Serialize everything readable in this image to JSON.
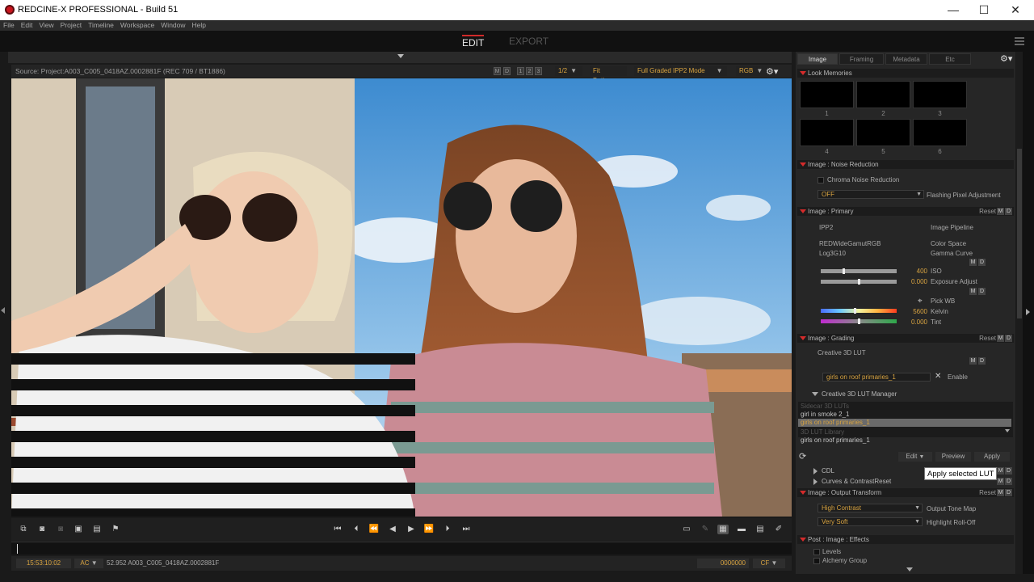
{
  "window": {
    "title": "REDCINE-X PROFESSIONAL - Build 51",
    "minimize": "—",
    "maximize": "☐",
    "close": "✕"
  },
  "menu": [
    "File",
    "Edit",
    "View",
    "Project",
    "Timeline",
    "Workspace",
    "Window",
    "Help"
  ],
  "modes": {
    "edit": "EDIT",
    "export": "EXPORT"
  },
  "viewer": {
    "source": "Source: Project:A003_C005_0418AZ.0002881F    (REC 709 / BT1886)",
    "m": "M",
    "d": "D",
    "pages": [
      "1",
      "2",
      "3"
    ],
    "zoom": "1/2",
    "fit": "Fit Both",
    "mode": "Full Graded IPP2 Mode",
    "channel": "RGB"
  },
  "transport": {
    "timecode": "15:53:10:02",
    "ac": "AC",
    "clip": "52.952 A003_C005_0418AZ.0002881F",
    "frame": "0000000",
    "cf": "CF"
  },
  "panel": {
    "tabs": [
      "Image",
      "Framing",
      "Metadata",
      "Etc"
    ],
    "look_memories": {
      "title": "Look Memories",
      "slots": [
        "1",
        "2",
        "3",
        "4",
        "5",
        "6"
      ]
    },
    "noise_reduction": {
      "title": "Image : Noise Reduction",
      "chroma": "Chroma Noise Reduction",
      "off": "OFF",
      "flashing": "Flashing Pixel Adjustment"
    },
    "primary": {
      "title": "Image : Primary",
      "reset": "Reset",
      "pipeline_value": "IPP2",
      "pipeline_label": "Image Pipeline",
      "colorspace_value": "REDWideGamutRGB",
      "colorspace_label": "Color Space",
      "gamma_value": "Log3G10",
      "gamma_label": "Gamma Curve",
      "iso_value": "400",
      "iso_label": "ISO",
      "iso_level": 0.3,
      "exposure_value": "0.000",
      "exposure_label": "Exposure Adjust",
      "exposure_level": 0.5,
      "pick_wb": "Pick WB",
      "kelvin_value": "5600",
      "kelvin_label": "Kelvin",
      "kelvin_level": 0.45,
      "tint_value": "0.000",
      "tint_label": "Tint",
      "tint_level": 0.5
    },
    "grading": {
      "title": "Image : Grading",
      "reset": "Reset",
      "creative_lut": "Creative 3D LUT",
      "lut_value": "girls on roof primaries_1",
      "enable": "Enable"
    },
    "lut_manager": {
      "title": "Creative 3D LUT Manager",
      "sidecar_header": "Sidecar 3D LUTs",
      "sidecar_items": [
        "girl in smoke 2_1",
        "girls on roof primaries_1"
      ],
      "library_header": "3D LUT Library",
      "library_items": [
        "girls on roof primaries_1"
      ],
      "edit": "Edit",
      "preview": "Preview",
      "apply": "Apply"
    },
    "cdl": {
      "title": "CDL"
    },
    "curves": {
      "title": "Curves & Contrast",
      "reset": "Reset"
    },
    "output": {
      "title": "Image : Output Transform",
      "reset": "Reset",
      "tonemap_value": "High Contrast",
      "tonemap_label": "Output Tone Map",
      "rolloff_value": "Very Soft",
      "rolloff_label": "Highlight Roll-Off"
    },
    "effects": {
      "title": "Post : Image : Effects",
      "levels": "Levels",
      "alchemy": "Alchemy Group"
    }
  },
  "tooltip": "Apply selected LUT"
}
